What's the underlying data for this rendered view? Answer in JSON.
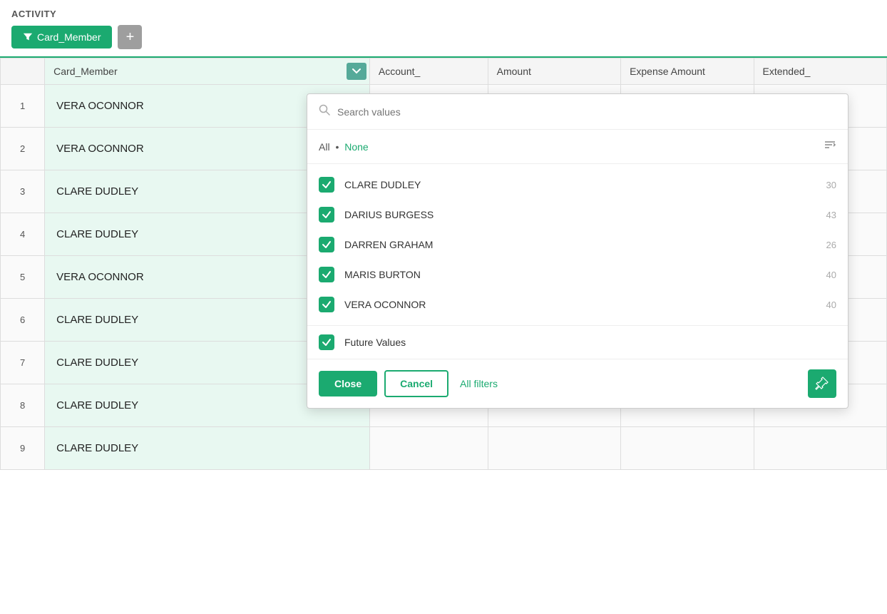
{
  "header": {
    "title": "ACTIVITY"
  },
  "toolbar": {
    "filter_label": "Card_Member",
    "add_label": "+"
  },
  "table": {
    "columns": [
      {
        "key": "row_num",
        "label": ""
      },
      {
        "key": "card_member",
        "label": "Card_Member"
      },
      {
        "key": "account",
        "label": "Account_"
      },
      {
        "key": "amount",
        "label": "Amount"
      },
      {
        "key": "expense_amount",
        "label": "Expense Amount"
      },
      {
        "key": "extended",
        "label": "Extended_"
      }
    ],
    "rows": [
      {
        "row_num": 1,
        "card_member": "VERA OCONNOR"
      },
      {
        "row_num": 2,
        "card_member": "VERA OCONNOR"
      },
      {
        "row_num": 3,
        "card_member": "CLARE DUDLEY"
      },
      {
        "row_num": 4,
        "card_member": "CLARE DUDLEY"
      },
      {
        "row_num": 5,
        "card_member": "VERA OCONNOR"
      },
      {
        "row_num": 6,
        "card_member": "CLARE DUDLEY"
      },
      {
        "row_num": 7,
        "card_member": "CLARE DUDLEY"
      },
      {
        "row_num": 8,
        "card_member": "CLARE DUDLEY"
      },
      {
        "row_num": 9,
        "card_member": "CLARE DUDLEY"
      }
    ]
  },
  "dropdown": {
    "search_placeholder": "Search values",
    "all_label": "All",
    "none_label": "None",
    "items": [
      {
        "label": "CLARE DUDLEY",
        "count": 30,
        "checked": true
      },
      {
        "label": "DARIUS BURGESS",
        "count": 43,
        "checked": true
      },
      {
        "label": "DARREN GRAHAM",
        "count": 26,
        "checked": true
      },
      {
        "label": "MARIS BURTON",
        "count": 40,
        "checked": true
      },
      {
        "label": "VERA OCONNOR",
        "count": 40,
        "checked": true
      }
    ],
    "future_values": {
      "label": "Future Values",
      "checked": true
    },
    "buttons": {
      "close": "Close",
      "cancel": "Cancel",
      "all_filters": "All filters"
    }
  }
}
